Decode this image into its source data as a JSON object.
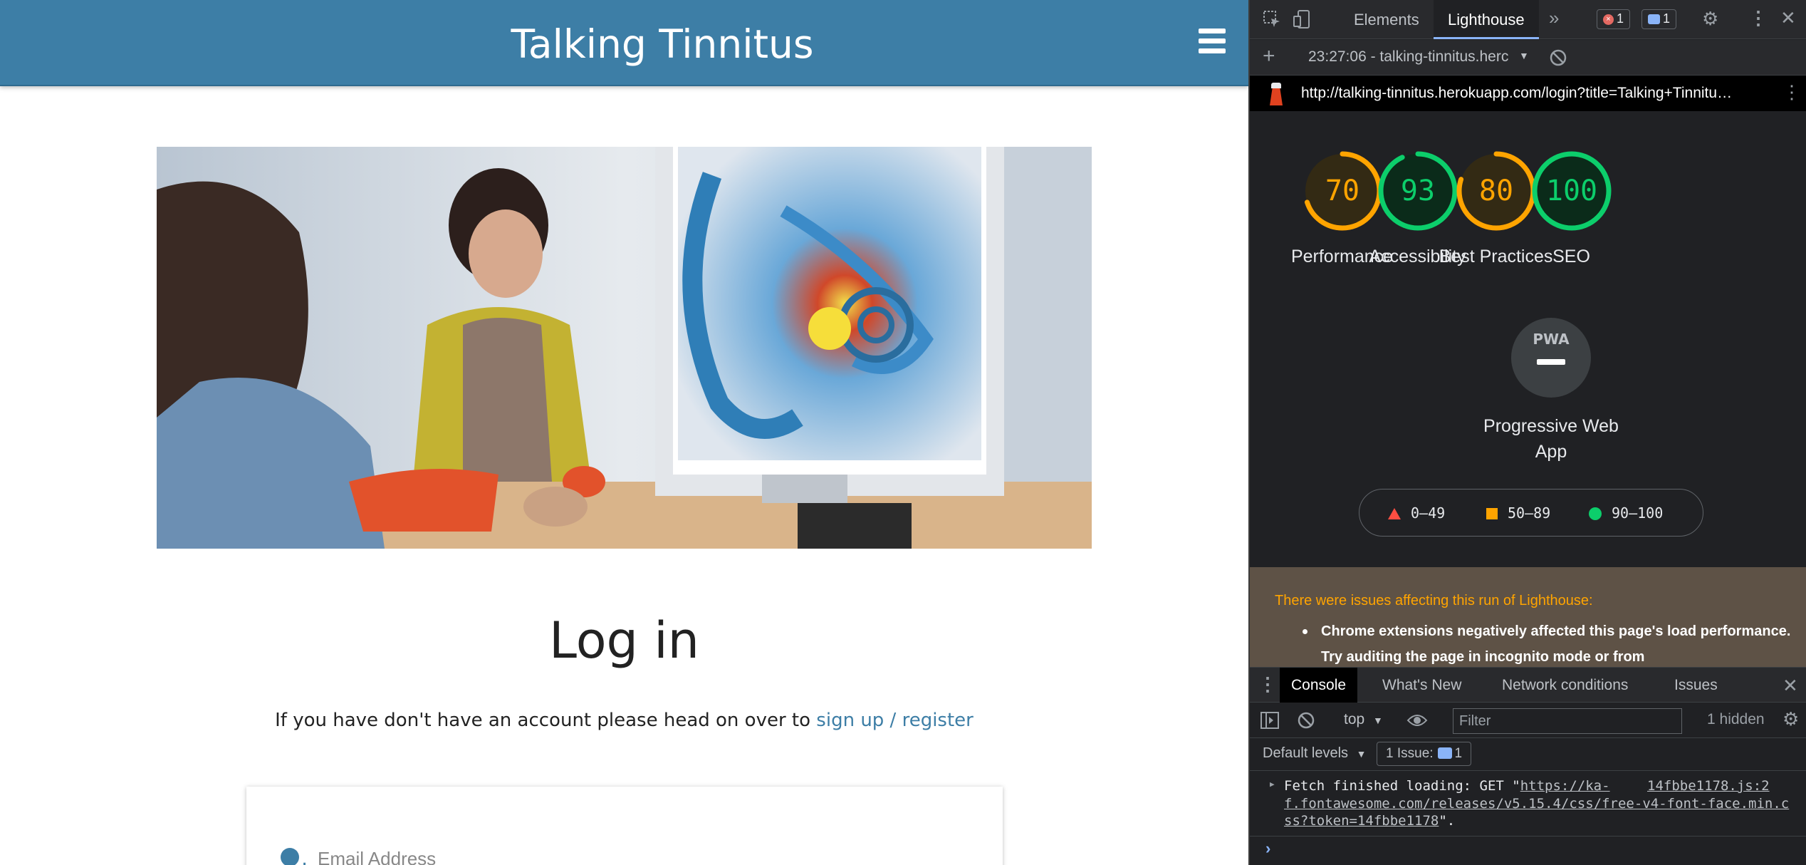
{
  "site": {
    "title": "Talking Tinnitus",
    "login_heading": "Log in",
    "signup_prefix": "If you have don't have an account please head on over to",
    "signup_link": "sign up / register",
    "email_placeholder": "Email Address"
  },
  "devtools": {
    "tabs": [
      {
        "label": "Elements",
        "active": false
      },
      {
        "label": "Lighthouse",
        "active": true
      }
    ],
    "error_count": "1",
    "message_count": "1",
    "report_selector": "23:27:06 - talking-tinnitus.herc",
    "report_url": "http://talking-tinnitus.herokuapp.com/login?title=Talking+Tinnitu…",
    "scores": [
      {
        "label": "Performance",
        "value": 70,
        "color": "#ffa400"
      },
      {
        "label": "Accessibility",
        "value": 93,
        "color": "#0cce6b"
      },
      {
        "label": "Best Practices",
        "value": 80,
        "color": "#ffa400"
      },
      {
        "label": "SEO",
        "value": 100,
        "color": "#0cce6b"
      }
    ],
    "pwa": {
      "badge": "PWA",
      "label": "Progressive Web App"
    },
    "legend": {
      "fail": "0–49",
      "average": "50–89",
      "pass": "90–100"
    },
    "warning": {
      "title": "There were issues affecting this run of Lighthouse:",
      "item": "Chrome extensions negatively affected this page's load performance. Try auditing the page in incognito mode or from"
    },
    "drawer_tabs": [
      {
        "label": "Console",
        "active": true
      },
      {
        "label": "What's New",
        "active": false
      },
      {
        "label": "Network conditions",
        "active": false
      },
      {
        "label": "Issues",
        "active": false
      }
    ],
    "console": {
      "context": "top",
      "filter_placeholder": "Filter",
      "hidden": "1 hidden",
      "levels": "Default levels",
      "issue_chip": "1 Issue:",
      "issue_count": "1",
      "log_prefix": "Fetch finished loading: GET \"",
      "log_url_start": "https://ka-",
      "log_source": "14fbbe1178.js:2",
      "log_url_rest": "f.fontawesome.com/releases/v5.15.4/css/free-v4-font-face.min.css?token=14fbbe1178",
      "log_suffix": "\"."
    }
  }
}
